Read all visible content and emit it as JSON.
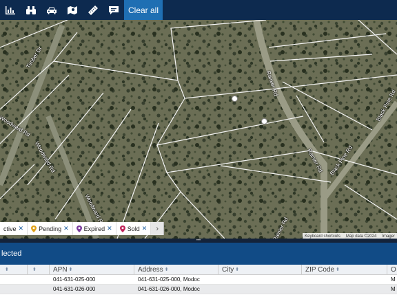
{
  "toolbar": {
    "icons": [
      "bar-chart-icon",
      "binoculars-icon",
      "car-icon",
      "map-icon",
      "ruler-icon",
      "comment-icon"
    ],
    "clear_label": "Clear all"
  },
  "map": {
    "road_labels": [
      "Timber Dr",
      "Woodward Rd",
      "Woodward Rd",
      "Woodward Rd",
      "Rainier Rd",
      "Rainier Rd",
      "Rainier Rd",
      "Black Pine Rd",
      "Black Pine Rd"
    ],
    "attribution": [
      "Keyboard shortcuts",
      "Map data ©2024",
      "Imager"
    ]
  },
  "filters": [
    {
      "label": "ctive",
      "color": "#2e8b3a"
    },
    {
      "label": "Pending",
      "color": "#e0a21a"
    },
    {
      "label": "Expired",
      "color": "#7a3c9c"
    },
    {
      "label": "Sold",
      "color": "#c0245a"
    }
  ],
  "filter_more": "›",
  "handle": "•••",
  "selection": {
    "title": "lected"
  },
  "table": {
    "columns": [
      "",
      "",
      "APN",
      "Address",
      "City",
      "ZIP Code",
      "O"
    ],
    "rows": [
      [
        "",
        "",
        "041-631-025-000",
        "041-631-025-000, Modoc",
        "",
        "",
        "M"
      ],
      [
        "",
        "",
        "041-631-026-000",
        "041-631-026-000, Modoc",
        "",
        "",
        "M"
      ]
    ]
  }
}
